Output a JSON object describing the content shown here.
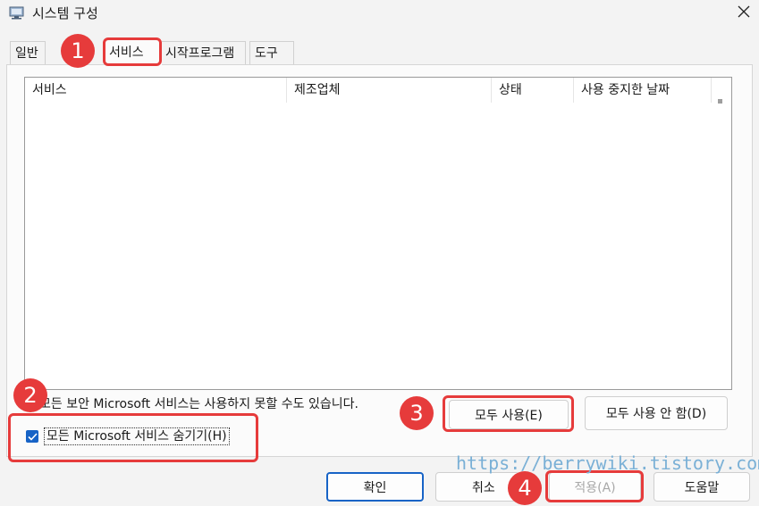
{
  "window": {
    "title": "시스템 구성",
    "icon": "msconfig-icon",
    "close_icon": "close-icon"
  },
  "tabs": [
    {
      "label": "일반"
    },
    {
      "label": "서비스"
    },
    {
      "label": "시작프로그램"
    },
    {
      "label": "도구"
    }
  ],
  "services_list": {
    "columns": [
      "서비스",
      "제조업체",
      "상태",
      "사용 중지한 날짜"
    ],
    "rows": []
  },
  "note": "모든 보안 Microsoft 서비스는 사용하지 못할 수도 있습니다.",
  "hide_ms_services": {
    "label": "모든 Microsoft 서비스 숨기기(H)",
    "checked": true
  },
  "buttons": {
    "enable_all": "모두 사용(E)",
    "disable_all": "모두 사용 안 함(D)",
    "ok": "확인",
    "cancel": "취소",
    "apply": "적용(A)",
    "help": "도움말"
  },
  "annotations": {
    "badges": [
      "1",
      "2",
      "3",
      "4"
    ],
    "color": "#e63b3b"
  },
  "watermark": "https://berrywiki.tistory.com",
  "colors": {
    "accent": "#1763c6",
    "highlight": "#e63b3b",
    "watermark": "#7ab0d6"
  }
}
